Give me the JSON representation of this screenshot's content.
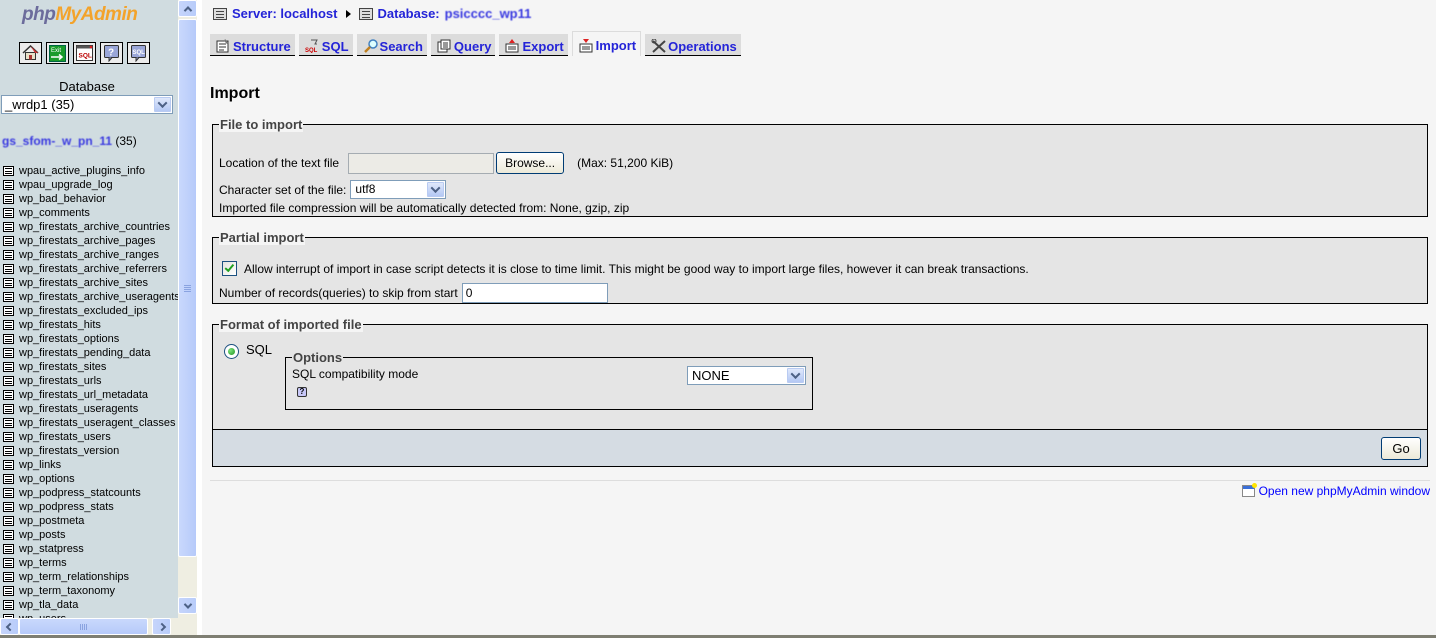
{
  "nav": {
    "logo_php": "php",
    "logo_myadmin": "MyAdmin",
    "quick_icons": [
      {
        "name": "home-icon",
        "label": ""
      },
      {
        "name": "exit-icon",
        "label": "Exit"
      },
      {
        "name": "query-window-icon",
        "label": "SQL"
      },
      {
        "name": "docs-icon",
        "label": "?"
      },
      {
        "name": "sql-docs-icon",
        "label": "SQL"
      }
    ],
    "database_label": "Database",
    "database_selected": "_wrdp1 (35)",
    "current_db_name": "gs_sfom-_w_pn_11",
    "current_db_count": "(35)",
    "tables": [
      "wpau_active_plugins_info",
      "wpau_upgrade_log",
      "wp_bad_behavior",
      "wp_comments",
      "wp_firestats_archive_countries",
      "wp_firestats_archive_pages",
      "wp_firestats_archive_ranges",
      "wp_firestats_archive_referrers",
      "wp_firestats_archive_sites",
      "wp_firestats_archive_useragents",
      "wp_firestats_excluded_ips",
      "wp_firestats_hits",
      "wp_firestats_options",
      "wp_firestats_pending_data",
      "wp_firestats_sites",
      "wp_firestats_urls",
      "wp_firestats_url_metadata",
      "wp_firestats_useragents",
      "wp_firestats_useragent_classes",
      "wp_firestats_users",
      "wp_firestats_version",
      "wp_links",
      "wp_options",
      "wp_podpress_statcounts",
      "wp_podpress_stats",
      "wp_postmeta",
      "wp_posts",
      "wp_statpress",
      "wp_terms",
      "wp_term_relationships",
      "wp_term_taxonomy",
      "wp_tla_data",
      "wp_users"
    ]
  },
  "breadcrumb": {
    "server": "Server: localhost",
    "database_prefix": "Database:",
    "database_name": "psicccc_wp11"
  },
  "tabs": [
    {
      "label": "Structure",
      "icon": "structure-icon",
      "active": false
    },
    {
      "label": "SQL",
      "icon": "sql-icon",
      "active": false
    },
    {
      "label": "Search",
      "icon": "search-icon",
      "active": false
    },
    {
      "label": "Query",
      "icon": "query-icon",
      "active": false
    },
    {
      "label": "Export",
      "icon": "export-icon",
      "active": false
    },
    {
      "label": "Import",
      "icon": "import-icon",
      "active": true
    },
    {
      "label": "Operations",
      "icon": "operations-icon",
      "active": false
    }
  ],
  "page_title": "Import",
  "file_to_import": {
    "legend": "File to import",
    "location_label": "Location of the text file",
    "location_value": "",
    "browse_label": "Browse...",
    "max_size": "(Max: 51,200 KiB)",
    "charset_label": "Character set of the file:",
    "charset_value": "utf8",
    "compression_note": "Imported file compression will be automatically detected from: None, gzip, zip"
  },
  "partial_import": {
    "legend": "Partial import",
    "allow_interrupt_label": "Allow interrupt of import in case script detects it is close to time limit. This might be good way to import large files, however it can break transactions.",
    "allow_interrupt_checked": true,
    "skip_label": "Number of records(queries) to skip from start",
    "skip_value": "0"
  },
  "format": {
    "legend": "Format of imported file",
    "sql_label": "SQL",
    "sql_selected": true,
    "options_legend": "Options",
    "compat_label": "SQL compatibility mode",
    "compat_value": "NONE"
  },
  "go_label": "Go",
  "open_new_window": "Open new phpMyAdmin window"
}
